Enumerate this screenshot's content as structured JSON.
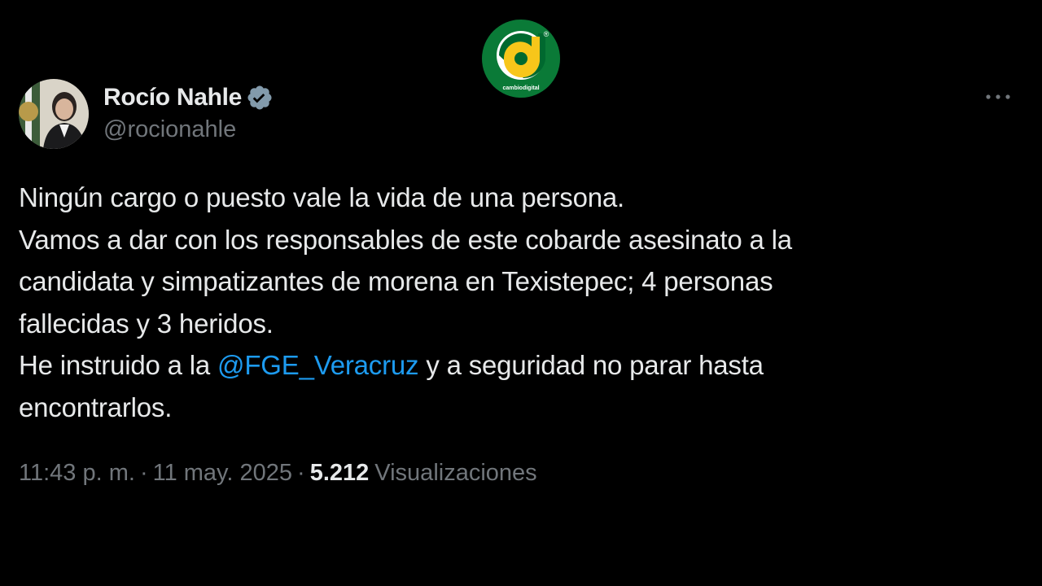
{
  "watermark": {
    "brand_text": "cambiodigital",
    "registered_mark": "®",
    "colors": {
      "ring": "#0a7a37",
      "disc": "#ffffff",
      "letter": "#f7c61a",
      "letter_dark": "#00692f"
    }
  },
  "tweet": {
    "author": {
      "display_name": "Rocío Nahle",
      "handle": "@rocionahle",
      "verified": true,
      "verified_badge_color": "#829aab",
      "avatar_icon": "profile-photo"
    },
    "more_icon": "more-horizontal-icon",
    "text": {
      "line1": "Ningún cargo o puesto vale la vida de una persona.",
      "line2": "Vamos a dar con los responsables de este cobarde asesinato a la",
      "line3": "candidata y simpatizantes de morena en Texistepec; 4 personas",
      "line4": "fallecidas y 3 heridos.",
      "line5_before": "He instruido a la ",
      "line5_mention": "@FGE_Veracruz",
      "line5_after": " y a seguridad no parar hasta",
      "line6": "encontrarlos."
    },
    "meta": {
      "time": "11:43 p. m.",
      "separator": "·",
      "date": "11 may. 2025",
      "views_count": "5.212",
      "views_label": "Visualizaciones"
    }
  },
  "colors": {
    "background": "#000000",
    "text_primary": "#e7e9ea",
    "text_secondary": "#71767b",
    "link": "#1d9bf0"
  }
}
